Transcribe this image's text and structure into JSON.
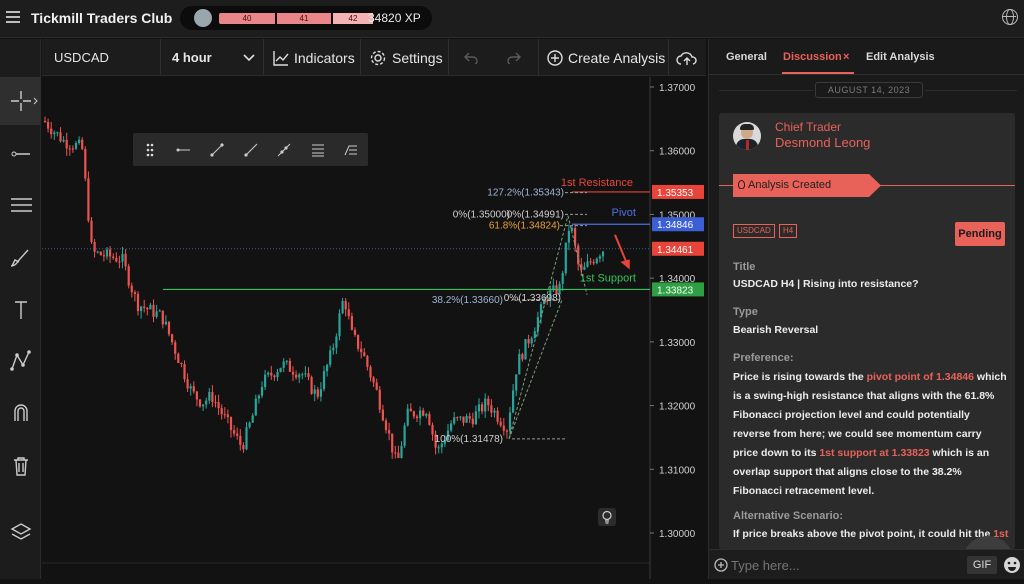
{
  "header": {
    "title": "Tickmill Traders Club",
    "xp_levels": [
      "40",
      "41",
      "42"
    ],
    "xp": "34820 XP"
  },
  "toolbar": {
    "symbol": "USDCAD",
    "timeframe": "4 hour",
    "indicators": "Indicators",
    "settings": "Settings",
    "create": "Create Analysis"
  },
  "chart": {
    "price_ticks": [
      "1.37000",
      "1.36000",
      "1.35000",
      "1.34000",
      "1.33000",
      "1.32000",
      "1.31000",
      "1.30000"
    ],
    "price_tags": [
      {
        "text": "1.35353",
        "color": "#e8443a"
      },
      {
        "text": "1.34846",
        "color": "#3d5fd6"
      },
      {
        "text": "1.34461",
        "color": "#e8443a"
      },
      {
        "text": "1.33823",
        "color": "#2ea043"
      }
    ],
    "labels": {
      "res": "1st Resistance",
      "pivot": "Pivot",
      "support": "1st Support",
      "fib127": "127.2%(1.35343)",
      "fib0a": "0%(1.35000)",
      "fib0b": "0%(1.34991)",
      "fib618": "61.8%(1.34824)",
      "fib382": "38.2%(1.33660)",
      "fib0c": "0%(1.33698)",
      "fib100": "100%(1.31478)"
    },
    "colors": {
      "up": "#26a69a",
      "down": "#ef5350",
      "resistance": "#e8443a",
      "pivot": "#4d6fe0",
      "support": "#36c25a"
    }
  },
  "panel": {
    "tabs": [
      "General",
      "Discussion",
      "Edit Analysis"
    ],
    "date": "AUGUST 14, 2023",
    "role": "Chief Trader",
    "name": "Desmond Leong",
    "banner": "Analysis Created",
    "tags": [
      "USDCAD",
      "H4"
    ],
    "status": "Pending",
    "title_label": "Title",
    "title": "USDCAD H4 | Rising into resistance?",
    "type_label": "Type",
    "type": "Bearish Reversal",
    "pref_label": "Preference:",
    "pref": {
      "a": "Price is rising towards the ",
      "b": "pivot point of 1.34846",
      "c": " which is a swing-high resistance that aligns with the 61.8% Fibonacci projection level and could potentially reverse from here; we could see momentum carry price down to its ",
      "d": "1st support at 1.33823",
      "e": " which is an overlap support that aligns close to the 38.2% Fibonacci retracement level."
    },
    "alt_label": "Alternative Scenario:",
    "alt": {
      "a": "If price breaks above the pivot point, it could hit the ",
      "b": "1st"
    },
    "placeholder": "Type here...",
    "gif": "GIF"
  }
}
